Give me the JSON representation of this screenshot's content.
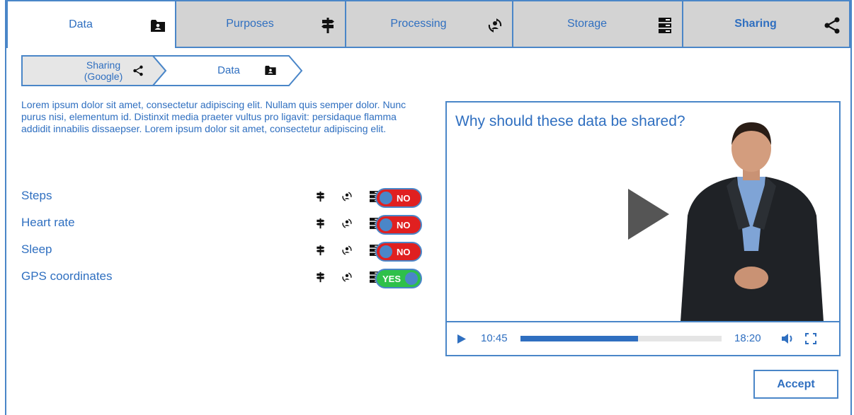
{
  "tabs": [
    {
      "label": "Data",
      "icon": "folder-person-icon",
      "active": true
    },
    {
      "label": "Purposes",
      "icon": "signpost-icon"
    },
    {
      "label": "Processing",
      "icon": "processing-person-icon"
    },
    {
      "label": "Storage",
      "icon": "server-icon"
    },
    {
      "label": "Sharing",
      "icon": "share-icon"
    }
  ],
  "breadcrumb": {
    "first": "Sharing\n(Google)",
    "first_icon": "share-icon",
    "second": "Data",
    "second_icon": "folder-person-icon"
  },
  "intro": "Lorem ipsum dolor sit amet, consectetur adipiscing elit. Nullam quis semper dolor. Nunc purus nisi, elementum id. Distinxit  media praeter vultus pro ligavit: persidaque flamma addidit innabilis dissaepser. Lorem ipsum dolor sit amet, consectetur adipiscing elit.",
  "rows": [
    {
      "label": "Steps",
      "toggle": "NO"
    },
    {
      "label": "Heart rate",
      "toggle": "NO"
    },
    {
      "label": "Sleep",
      "toggle": "NO"
    },
    {
      "label": "GPS coordinates",
      "toggle": "YES"
    }
  ],
  "video": {
    "title": "Why should these data be shared?",
    "current_time": "10:45",
    "total_time": "18:20",
    "progress": 0.585
  },
  "accept_label": "Accept",
  "colors": {
    "accent": "#4a86c8",
    "text": "#2f6fc0",
    "no": "#e02020",
    "yes": "#2ec04a"
  }
}
